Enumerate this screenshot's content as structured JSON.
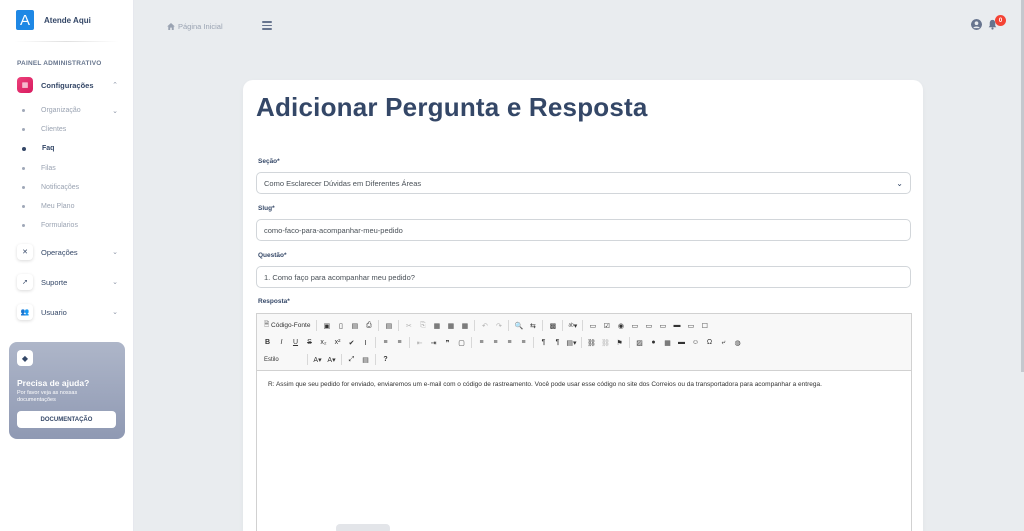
{
  "brand": {
    "logo_letter": "A",
    "name": "Atende Aqui",
    "logo_color": "#1e88e5"
  },
  "sidebar": {
    "section_title": "PAINEL ADMINISTRATIVO",
    "groups": [
      {
        "label": "Configurações",
        "icon": "settings-icon",
        "expanded": true,
        "active": true
      },
      {
        "label": "Operações",
        "icon": "tools-icon"
      },
      {
        "label": "Suporte",
        "icon": "rocket-icon"
      },
      {
        "label": "Usuario",
        "icon": "users-icon"
      }
    ],
    "config_items": [
      {
        "label": "Organização",
        "has_chevron": true
      },
      {
        "label": "Clientes"
      },
      {
        "label": "Faq",
        "active": true
      },
      {
        "label": "Filas"
      },
      {
        "label": "Notificações"
      },
      {
        "label": "Meu Plano"
      },
      {
        "label": "Formularios"
      }
    ],
    "help": {
      "title": "Precisa de ajuda?",
      "subtitle": "Por favor veja as nossas documentações",
      "button": "DOCUMENTAÇÃO"
    }
  },
  "topbar": {
    "breadcrumb": "Página Inicial",
    "notification_count": "0"
  },
  "page": {
    "title": "Adicionar Pergunta e Resposta"
  },
  "form": {
    "secao": {
      "label": "Seção*",
      "value": "Como Esclarecer Dúvidas em Diferentes Áreas"
    },
    "slug": {
      "label": "Slug*",
      "value": "como-faco-para-acompanhar-meu-pedido"
    },
    "questao": {
      "label": "Questão*",
      "value": "1. Como faço para acompanhar meu pedido?"
    },
    "resposta": {
      "label": "Resposta*",
      "toolbar": {
        "source_button": "Código-Fonte",
        "style_combo": "Estilo"
      },
      "content": "R: Assim que seu pedido for enviado, enviaremos um e-mail com o código de rastreamento. Você pode usar esse código no site dos Correios ou da transportadora para acompanhar a entrega."
    }
  },
  "colors": {
    "accent": "#e91e63",
    "text": "#344767",
    "badge": "#f44335"
  }
}
